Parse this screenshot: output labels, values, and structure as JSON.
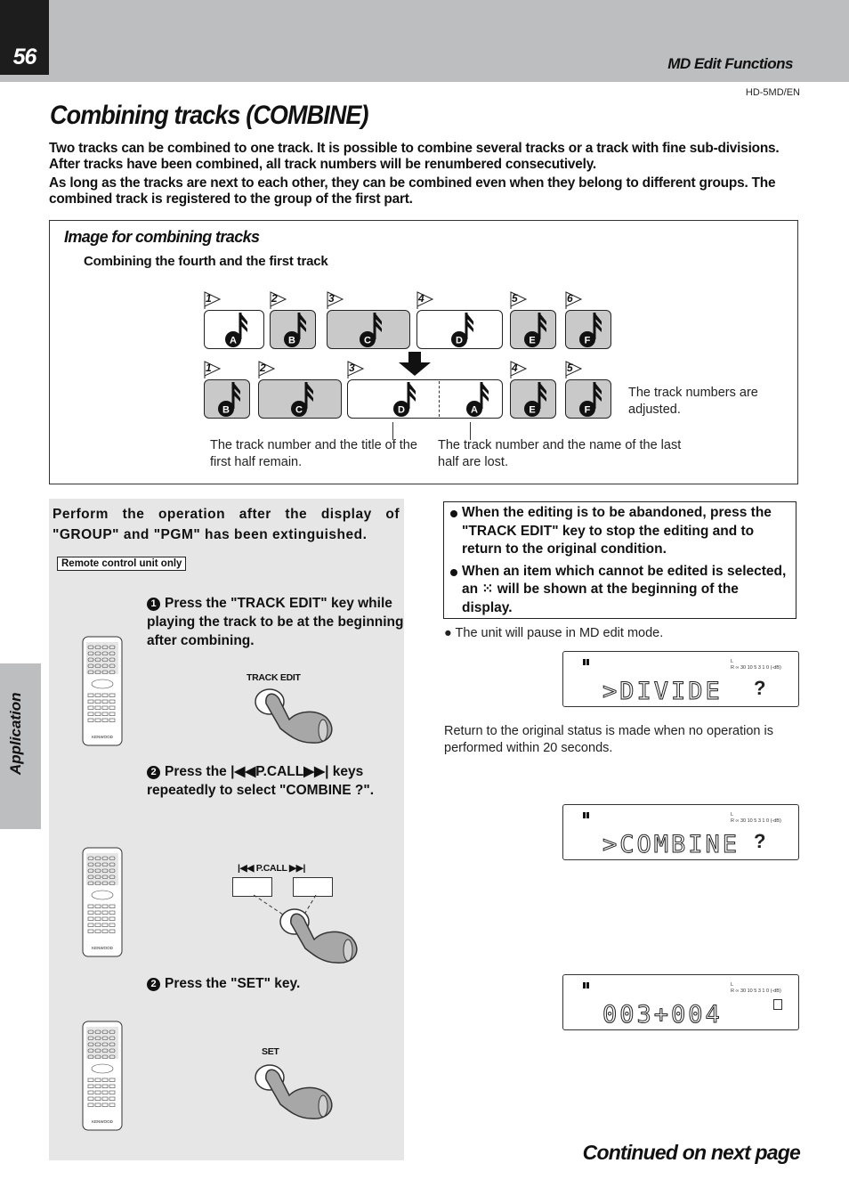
{
  "header": {
    "page_number": "56",
    "section_title": "MD Edit Functions",
    "model": "HD-5MD/EN"
  },
  "title": "Combining tracks (COMBINE)",
  "intro": [
    "Two tracks can be combined to one track. It is possible to combine several tracks or a track with fine sub-divisions. After tracks have been combined, all track numbers will be renumbered consecutively.",
    "As long as the tracks are next to each other, they can be combined even when they belong to different groups. The combined track is registered to the group of the first part."
  ],
  "image_box": {
    "title": "Image for combining tracks",
    "subtitle": "Combining the fourth and the first track",
    "before": [
      {
        "num": "1",
        "letter": "A",
        "gray": false
      },
      {
        "num": "2",
        "letter": "B",
        "gray": true
      },
      {
        "num": "3",
        "letter": "C",
        "gray": true
      },
      {
        "num": "4",
        "letter": "D",
        "gray": false
      },
      {
        "num": "5",
        "letter": "E",
        "gray": true
      },
      {
        "num": "6",
        "letter": "F",
        "gray": true
      }
    ],
    "after": [
      {
        "num": "1",
        "letter": "B"
      },
      {
        "num": "2",
        "letter": "C"
      },
      {
        "num": "3",
        "letter": "D",
        "letter2": "A"
      },
      {
        "num": "4",
        "letter": "E"
      },
      {
        "num": "5",
        "letter": "F"
      }
    ],
    "caption_adjusted": "The track numbers are adjusted.",
    "caption_first_half": "The track number and the title of the first half remain.",
    "caption_last_half": "The track number and the name of the last half are lost."
  },
  "procedure": {
    "heading": "Perform the operation after the display of \"GROUP\" and \"PGM\" has been extinguished.",
    "remote_only": "Remote control unit only",
    "steps": [
      {
        "num": "1",
        "text": "Press the \"TRACK EDIT\" key while playing the track to be at the beginning after combining.",
        "key_label": "TRACK EDIT"
      },
      {
        "num": "2",
        "text": "Press the |◀◀P.CALL▶▶| keys repeatedly to select \"COMBINE ?\".",
        "key_label": "|◀◀  P.CALL  ▶▶|"
      },
      {
        "num": "2",
        "text": "Press the \"SET\" key.",
        "key_label": "SET"
      }
    ],
    "remote_brand": "KENWOOD"
  },
  "notes": {
    "abandon": "When the editing is to be abandoned, press the \"TRACK EDIT\" key to stop the editing and to return to the original condition.",
    "cannot_edit": "When an item which cannot be edited is selected, an ⁙ will be shown at the beginning of the display.",
    "pause": "The unit will pause in MD edit mode.",
    "timeout": "Return to the original status is made when no operation is performed within 20 seconds."
  },
  "displays": [
    {
      "text": ">DIVIDE",
      "blink": "?",
      "meter": "∞ 30 10 5 3 1 0 (-dB)"
    },
    {
      "text": ">COMBINE",
      "blink": "?",
      "meter": "∞ 30 10 5 3 1 0 (-dB)"
    },
    {
      "text": "003+004",
      "blink": "",
      "meter": "∞ 30 10 5 3 1 0 (-dB)"
    }
  ],
  "side_tab": "Application",
  "continued": "Continued on next page"
}
